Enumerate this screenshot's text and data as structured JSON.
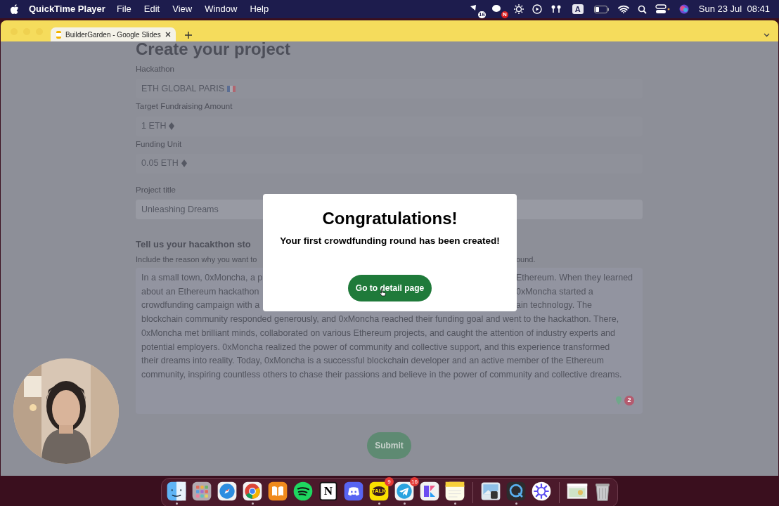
{
  "menu_bar": {
    "app": "QuickTime Player",
    "menus": [
      "File",
      "Edit",
      "View",
      "Window",
      "Help"
    ],
    "status_icons": [
      {
        "kind": "recorder",
        "badge": "16"
      },
      {
        "kind": "chat",
        "badge": "N"
      },
      {
        "kind": "brightness"
      },
      {
        "kind": "play"
      },
      {
        "kind": "earbuds"
      },
      {
        "kind": "input",
        "label": "A"
      },
      {
        "kind": "battery"
      },
      {
        "kind": "wifi"
      },
      {
        "kind": "search"
      },
      {
        "kind": "control"
      },
      {
        "kind": "siri"
      }
    ],
    "clock": "Sun 23 Jul  08:41"
  },
  "browser": {
    "tabs": [
      {
        "title": "BuilderGarden - Google Slides",
        "selected": true
      }
    ]
  },
  "form": {
    "title": "Create your project",
    "fields": [
      {
        "label": "Hackathon",
        "value": "ETH GLOBAL PARIS",
        "kind": "country"
      },
      {
        "label": "Target Fundraising Amount",
        "value": "1 ETH",
        "kind": "amount"
      },
      {
        "label": "Funding Unit",
        "value": "0.05 ETH",
        "kind": "amount"
      },
      {
        "label": "Project title",
        "value": "Unleashing Dreams",
        "kind": "text"
      }
    ],
    "story": {
      "heading": "Tell us your hacakthon sto",
      "hint": [
        "Include the reason why you want to",
        "ound."
      ],
      "lines": [
        [
          "In a small town, 0xMoncha, a p",
          "Ethereum. When they learned"
        ],
        [
          "about an Ethereum hackathon",
          "0xMoncha started a"
        ],
        [
          "crowdfunding campaign with a",
          "ain technology. The"
        ],
        [
          "blockchain community responded generously, and 0xMoncha reached their funding goal and went to the hackathon. There,"
        ],
        [
          "0xMoncha met brilliant minds, collaborated on various Ethereum projects, and caught the attention of industry experts and"
        ],
        [
          "potential employers. 0xMoncha realized the power of community and collective support, and this experience transformed"
        ],
        [
          "their dreams into reality. Today, 0xMoncha is a successful blockchain developer and an active member of the Ethereum"
        ],
        [
          "community, inspiring countless others to chase their passions and believe in the power of community and collective dreams."
        ]
      ],
      "counter_badge": "2"
    },
    "submit": "Submit"
  },
  "dialog": {
    "title": "Congratulations!",
    "message": "Your first crowdfunding round has been created!",
    "button": "Go to detail page"
  },
  "dock": [
    {
      "kind": "finder",
      "running": true
    },
    {
      "kind": "launchpad",
      "running": false
    },
    {
      "kind": "safari",
      "running": false
    },
    {
      "kind": "chrome",
      "running": true
    },
    {
      "kind": "books",
      "running": false
    },
    {
      "kind": "spotify",
      "running": false
    },
    {
      "kind": "notion",
      "label": "N",
      "running": false
    },
    {
      "kind": "discord",
      "running": false
    },
    {
      "kind": "kakaotalk",
      "label": "TALK",
      "badge": "9",
      "running": true
    },
    {
      "kind": "telegram",
      "badge": "16",
      "running": true
    },
    {
      "kind": "craft",
      "running": false
    },
    {
      "kind": "notes",
      "running": true
    },
    {
      "kind": "separator"
    },
    {
      "kind": "preview",
      "running": false
    },
    {
      "kind": "quicktime",
      "running": true
    },
    {
      "kind": "asterisk",
      "running": false
    },
    {
      "kind": "separator"
    },
    {
      "kind": "window",
      "running": false
    },
    {
      "kind": "trash",
      "running": false
    }
  ]
}
